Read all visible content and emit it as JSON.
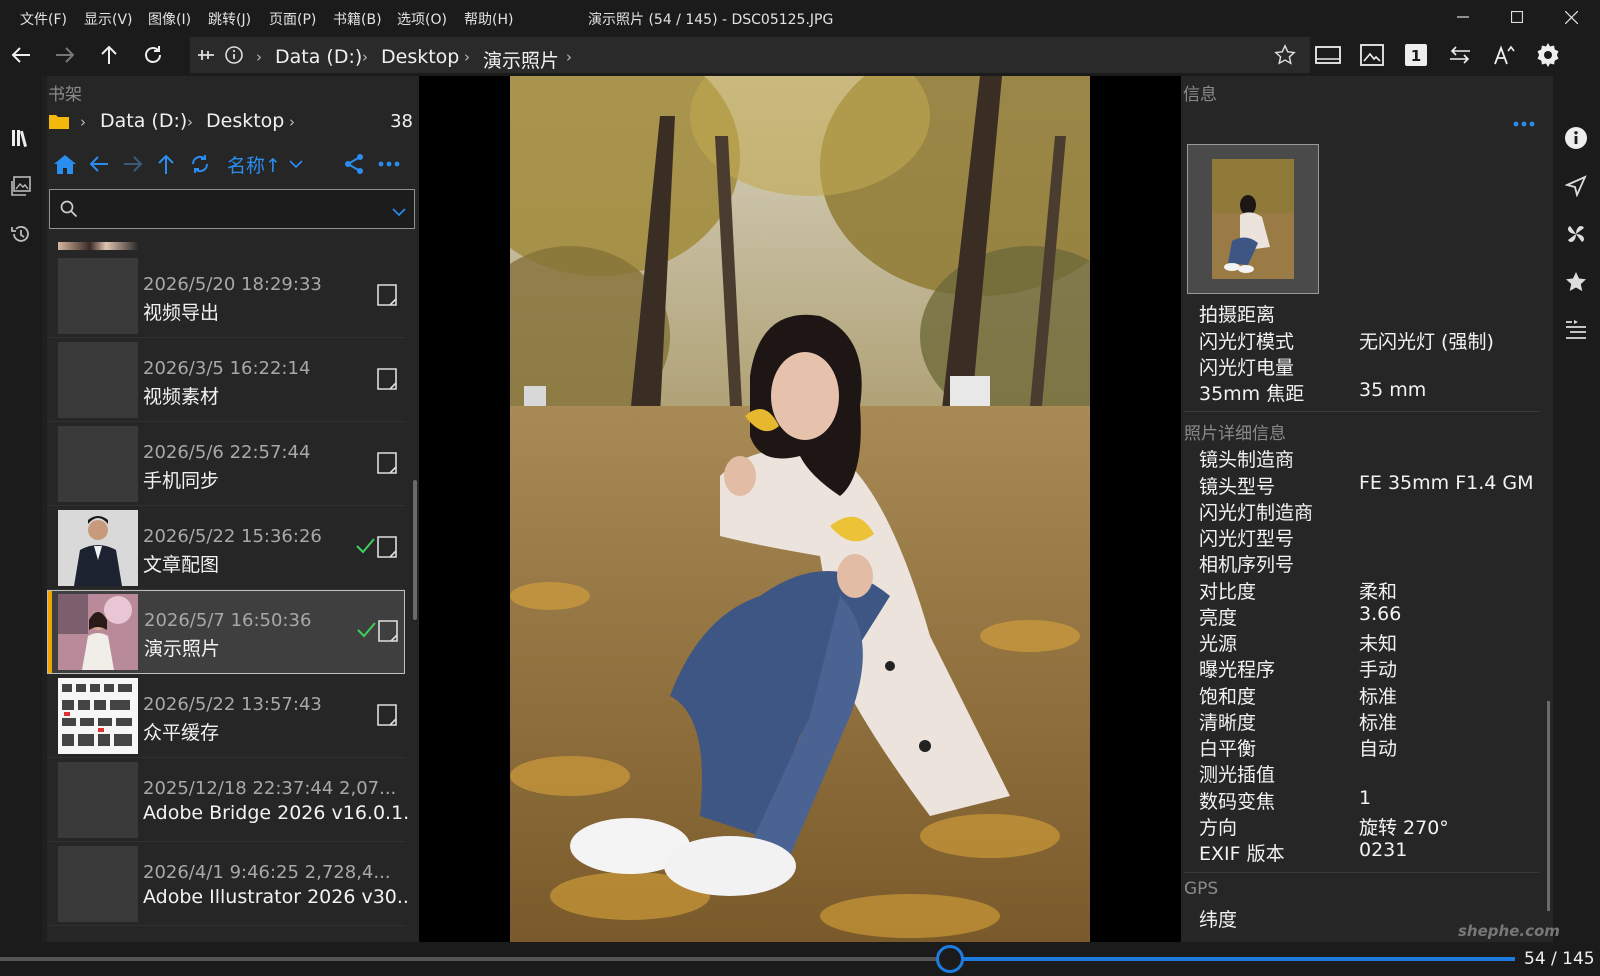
{
  "menu": [
    "文件(F)",
    "显示(V)",
    "图像(I)",
    "跳转(J)",
    "页面(P)",
    "书籍(B)",
    "选项(O)",
    "帮助(H)"
  ],
  "window_title": "演示照片 (54 / 145) - DSC05125.JPG",
  "address": [
    "Data (D:)",
    "Desktop",
    "演示照片"
  ],
  "bookshelf": {
    "title": "书架",
    "path": [
      "Data (D:)",
      "Desktop"
    ],
    "count": "38",
    "sort_label": "名称↑",
    "search_placeholder": "",
    "items": [
      {
        "date": "2026/5/20 18:29:33",
        "name": "视频导出",
        "checked": false,
        "selected": false
      },
      {
        "date": "2026/3/5 16:22:14",
        "name": "视频素材",
        "checked": false,
        "selected": false
      },
      {
        "date": "2026/5/6 22:57:44",
        "name": "手机同步",
        "checked": false,
        "selected": false
      },
      {
        "date": "2026/5/22 15:36:26",
        "name": "文章配图",
        "checked": true,
        "selected": false
      },
      {
        "date": "2026/5/7 16:50:36",
        "name": "演示照片",
        "checked": true,
        "selected": true
      },
      {
        "date": "2026/5/22 13:57:43",
        "name": "众平缓存",
        "checked": false,
        "selected": false
      },
      {
        "date": "2025/12/18 22:37:44   2,07...",
        "name": "Adobe Bridge 2026 v16.0.1...",
        "checked": false,
        "selected": false
      },
      {
        "date": "2026/4/1 9:46:25   2,728,4...",
        "name": "Adobe Illustrator 2026 v30...",
        "checked": false,
        "selected": false
      }
    ]
  },
  "info": {
    "title": "信息",
    "group1": [
      {
        "key": "拍摄距离",
        "value": ""
      },
      {
        "key": "闪光灯模式",
        "value": "无闪光灯 (强制)"
      },
      {
        "key": "闪光灯电量",
        "value": ""
      },
      {
        "key": "35mm 焦距",
        "value": "35 mm"
      }
    ],
    "section2": "照片详细信息",
    "group2": [
      {
        "key": "镜头制造商",
        "value": ""
      },
      {
        "key": "镜头型号",
        "value": "FE 35mm F1.4 GM"
      },
      {
        "key": "闪光灯制造商",
        "value": ""
      },
      {
        "key": "闪光灯型号",
        "value": ""
      },
      {
        "key": "相机序列号",
        "value": ""
      },
      {
        "key": "对比度",
        "value": "柔和"
      },
      {
        "key": "亮度",
        "value": "3.66"
      },
      {
        "key": "光源",
        "value": "未知"
      },
      {
        "key": "曝光程序",
        "value": "手动"
      },
      {
        "key": "饱和度",
        "value": "标准"
      },
      {
        "key": "清晰度",
        "value": "标准"
      },
      {
        "key": "白平衡",
        "value": "自动"
      },
      {
        "key": "测光插值",
        "value": ""
      },
      {
        "key": "数码变焦",
        "value": "1"
      },
      {
        "key": "方向",
        "value": "旋转 270°"
      },
      {
        "key": "EXIF 版本",
        "value": "0231"
      }
    ],
    "section3": "GPS",
    "group3": [
      {
        "key": "纬度",
        "value": ""
      }
    ]
  },
  "page": {
    "current": 54,
    "total": 145,
    "label": "54 / 145",
    "progress": 0.372
  },
  "watermark": "shephe.com",
  "colors": {
    "accent": "#1e7be0",
    "selected_marker": "#f0a500",
    "check": "#3fcf5a"
  }
}
